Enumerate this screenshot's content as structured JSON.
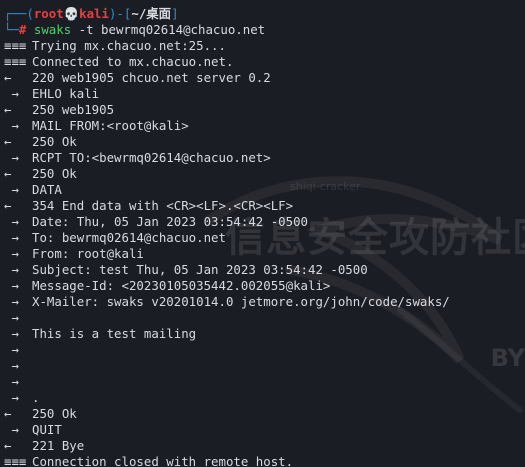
{
  "prompt": {
    "user": "root",
    "skull": "💀",
    "host": "kali",
    "path": "~/桌面",
    "command": "swaks",
    "args": "-t bewrmq02614@chacuo.net"
  },
  "lines": [
    {
      "marker": "===",
      "text": "Trying mx.chacuo.net:25..."
    },
    {
      "marker": "===",
      "text": "Connected to mx.chacuo.net."
    },
    {
      "marker": "<-",
      "text": "220 web1905 chcuo.net server 0.2"
    },
    {
      "marker": "->",
      "text": "EHLO kali"
    },
    {
      "marker": "<-",
      "text": "250 web1905"
    },
    {
      "marker": "->",
      "text": "MAIL FROM:<root@kali>"
    },
    {
      "marker": "<-",
      "text": "250 Ok"
    },
    {
      "marker": "->",
      "text": "RCPT TO:<bewrmq02614@chacuo.net>"
    },
    {
      "marker": "<-",
      "text": "250 Ok"
    },
    {
      "marker": "->",
      "text": "DATA"
    },
    {
      "marker": "<-",
      "text": "354 End data with <CR><LF>.<CR><LF>"
    },
    {
      "marker": "->",
      "text": "Date: Thu, 05 Jan 2023 03:54:42 -0500"
    },
    {
      "marker": "->",
      "text": "To: bewrmq02614@chacuo.net"
    },
    {
      "marker": "->",
      "text": "From: root@kali"
    },
    {
      "marker": "->",
      "text": "Subject: test Thu, 05 Jan 2023 03:54:42 -0500"
    },
    {
      "marker": "->",
      "text": "Message-Id: <20230105035442.002055@kali>"
    },
    {
      "marker": "->",
      "text": "X-Mailer: swaks v20201014.0 jetmore.org/john/code/swaks/"
    },
    {
      "marker": "->",
      "text": ""
    },
    {
      "marker": "->",
      "text": "This is a test mailing"
    },
    {
      "marker": "->",
      "text": ""
    },
    {
      "marker": "->",
      "text": ""
    },
    {
      "marker": "->",
      "text": ""
    },
    {
      "marker": "->",
      "text": "."
    },
    {
      "marker": "<-",
      "text": "250 Ok"
    },
    {
      "marker": "->",
      "text": "QUIT"
    },
    {
      "marker": "<-",
      "text": "221 Bye"
    },
    {
      "marker": "===",
      "text": "Connection closed with remote host."
    }
  ],
  "markers": {
    "===": "≡≡≡",
    "->": " →",
    "<-": "←"
  },
  "watermark": {
    "main": "信息安全攻防社区",
    "small": "shiqi-cracker",
    "by": "BY"
  },
  "colors": {
    "background": "#1b1d24",
    "prompt_bracket": "#2a8fd6",
    "prompt_user": "#e64040",
    "command": "#4fcf6b",
    "text": "#d7dadf"
  }
}
